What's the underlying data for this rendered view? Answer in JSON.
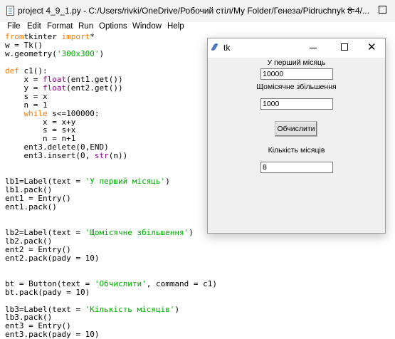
{
  "editor_window": {
    "title": "project 4_9_1.py - C:/Users/rivki/OneDrive/Робочий стіл/My Folder/Генеза/Pidruchnyk 8-4/...",
    "menu": [
      "File",
      "Edit",
      "Format",
      "Run",
      "Options",
      "Window",
      "Help"
    ],
    "code_lines": [
      [
        [
          "kw",
          "from"
        ],
        [
          "",
          "tkinter"
        ],
        [
          "kw",
          " import"
        ],
        [
          "",
          "*"
        ]
      ],
      [
        [
          "",
          "w = Tk()"
        ]
      ],
      [
        [
          "",
          "w.geometry("
        ],
        [
          "st",
          "'300x300'"
        ],
        [
          "",
          ")"
        ]
      ],
      [],
      [
        [
          "kw",
          "def"
        ],
        [
          "",
          " c1():"
        ]
      ],
      [
        [
          "",
          "    x = "
        ],
        [
          "bi",
          "float"
        ],
        [
          "",
          "(ent1.get())"
        ]
      ],
      [
        [
          "",
          "    y = "
        ],
        [
          "bi",
          "float"
        ],
        [
          "",
          "(ent2.get())"
        ]
      ],
      [
        [
          "",
          "    s = x"
        ]
      ],
      [
        [
          "",
          "    n = 1"
        ]
      ],
      [
        [
          "kw",
          "    while"
        ],
        [
          "",
          " s<=100000:"
        ]
      ],
      [
        [
          "",
          "        x = x+y"
        ]
      ],
      [
        [
          "",
          "        s = s+x"
        ]
      ],
      [
        [
          "",
          "        n = n+1"
        ]
      ],
      [
        [
          "",
          "    ent3.delete(0,END)"
        ]
      ],
      [
        [
          "",
          "    ent3.insert(0, "
        ],
        [
          "bi",
          "str"
        ],
        [
          "",
          "(n))"
        ]
      ],
      [],
      [],
      [
        [
          "",
          "lb1=Label(text = "
        ],
        [
          "st",
          "'У перший місяць'"
        ],
        [
          "",
          ")"
        ]
      ],
      [
        [
          "",
          "lb1.pack()"
        ]
      ],
      [
        [
          "",
          "ent1 = Entry()"
        ]
      ],
      [
        [
          "",
          "ent1.pack()"
        ]
      ],
      [],
      [],
      [
        [
          "",
          "lb2=Label(text = "
        ],
        [
          "st",
          "'Щомісячне збільшення'"
        ],
        [
          "",
          ")"
        ]
      ],
      [
        [
          "",
          "lb2.pack()"
        ]
      ],
      [
        [
          "",
          "ent2 = Entry()"
        ]
      ],
      [
        [
          "",
          "ent2.pack(pady = 10)"
        ]
      ],
      [],
      [],
      [
        [
          "",
          "bt = Button(text = "
        ],
        [
          "st",
          "'Обчислити'"
        ],
        [
          "",
          ", command = c1)"
        ]
      ],
      [
        [
          "",
          "bt.pack(pady = 10)"
        ]
      ],
      [],
      [
        [
          "",
          "lb3=Label(text = "
        ],
        [
          "st",
          "'Кількість місяців'"
        ],
        [
          "",
          ")"
        ]
      ],
      [
        [
          "",
          "lb3.pack()"
        ]
      ],
      [
        [
          "",
          "ent3 = Entry()"
        ]
      ],
      [
        [
          "",
          "ent3.pack(pady = 10)"
        ]
      ]
    ]
  },
  "tk_window": {
    "title": "tk",
    "close_glyph": "✕",
    "label1": "У перший місяць",
    "entry1_value": "10000",
    "label2": "Щомісячне збільшення",
    "entry2_value": "1000",
    "button_label": "Обчислити",
    "label3": "Кількість місяців",
    "entry3_value": "8"
  }
}
